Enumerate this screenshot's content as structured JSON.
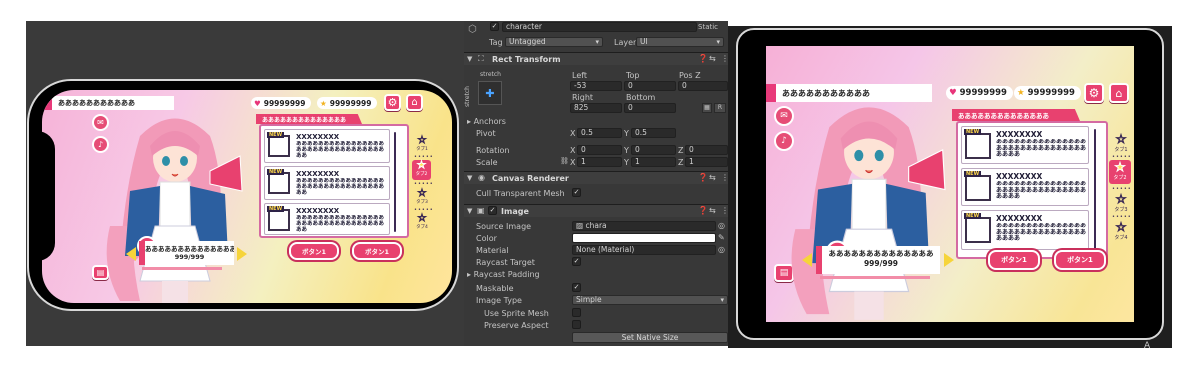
{
  "game": {
    "player_name": "あああああああああああ",
    "hearts": "99999999",
    "stars": "99999999",
    "panel_title": "ああああああああああああああ",
    "items": [
      {
        "badge": "NEW",
        "title": "XXXXXXXX",
        "text": "ああああああああああああああああああああああああああああああああああ"
      },
      {
        "badge": "NEW",
        "title": "XXXXXXXX",
        "text": "ああああああああああああああああああああああああああああああああああ"
      },
      {
        "badge": "NEW",
        "title": "XXXXXXXX",
        "text": "ああああああああああああああああああああああああああああああああああ"
      }
    ],
    "tabs": [
      "タブ1",
      "タブ2",
      "タブ3",
      "タブ4"
    ],
    "message": "ああああああああああああああ",
    "counter": "999/999",
    "button1": "ボタン1",
    "button2": "ボタン1",
    "colors": {
      "accent": "#e8416f",
      "navy": "#3c2a55",
      "star": "#f2b321"
    }
  },
  "inspector": {
    "object_name": "character",
    "static_label": "Static",
    "tag_label": "Tag",
    "tag_value": "Untagged",
    "layer_label": "Layer",
    "layer_value": "UI",
    "rect_transform": {
      "title": "Rect Transform",
      "anchor_preset": "stretch",
      "anchor_preset_side": "stretch",
      "left_label": "Left",
      "left": "-53",
      "top_label": "Top",
      "top": "0",
      "posz_label": "Pos Z",
      "posz": "0",
      "right_label": "Right",
      "right": "825",
      "bottom_label": "Bottom",
      "bottom": "0",
      "r_label": "R",
      "anchors_label": "Anchors",
      "pivot_label": "Pivot",
      "pivot_x": "0.5",
      "pivot_y": "0.5",
      "rotation_label": "Rotation",
      "rot_x": "0",
      "rot_y": "0",
      "rot_z": "0",
      "scale_label": "Scale",
      "scale_x": "1",
      "scale_y": "1",
      "scale_z": "1",
      "x": "X",
      "y": "Y",
      "z": "Z"
    },
    "canvas_renderer": {
      "title": "Canvas Renderer",
      "cull_label": "Cull Transparent Mesh"
    },
    "image": {
      "title": "Image",
      "source_label": "Source Image",
      "source_value": "chara",
      "color_label": "Color",
      "material_label": "Material",
      "material_value": "None (Material)",
      "raycast_target_label": "Raycast Target",
      "raycast_padding_label": "Raycast Padding",
      "maskable_label": "Maskable",
      "image_type_label": "Image Type",
      "image_type_value": "Simple",
      "use_sprite_mesh_label": "Use Sprite Mesh",
      "preserve_aspect_label": "Preserve Aspect",
      "set_native_size": "Set Native Size"
    }
  },
  "gameview_status": "A"
}
